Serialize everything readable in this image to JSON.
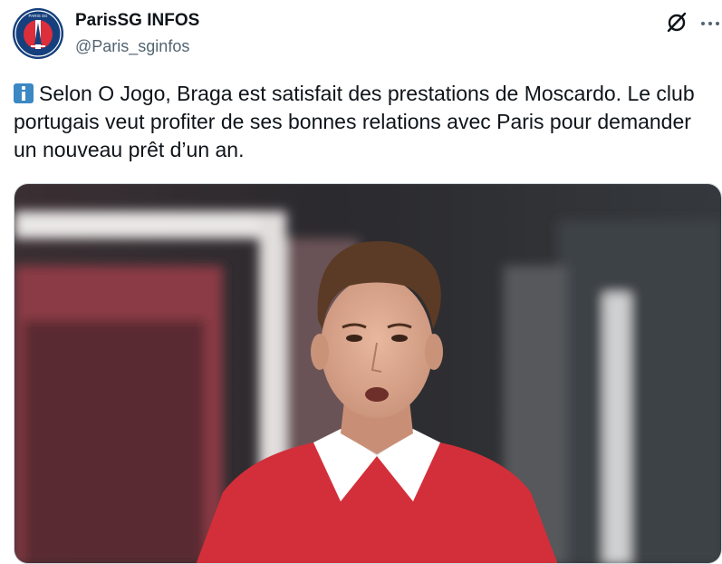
{
  "tweet": {
    "author": {
      "display_name": "ParisSG INFOS",
      "handle": "@Paris_sginfos",
      "avatar_icon": "psg-logo"
    },
    "emoji": "information-icon",
    "text": "Selon O Jogo, Braga est satisfait des prestations de Moscardo. Le club portugais veut profiter de ses bonnes relations avec Paris pour demander un nouveau prêt d’un an.",
    "actions": {
      "grok_icon": "grok-icon",
      "more_icon": "more-icon"
    },
    "media": {
      "type": "photo",
      "jersey_color": "#d32f3a",
      "collar_color": "#ffffff"
    }
  }
}
